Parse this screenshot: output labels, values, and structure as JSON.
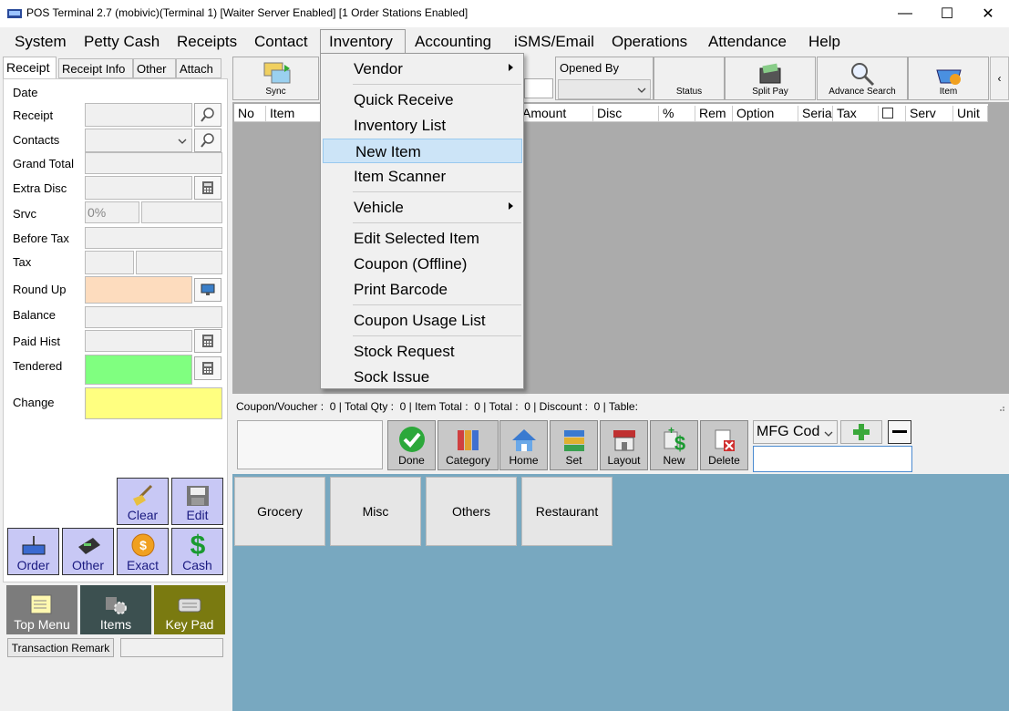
{
  "window": {
    "title": "POS Terminal 2.7 (mobivic)(Terminal 1) [Waiter Server Enabled] [1 Order Stations Enabled]",
    "minimize": "—",
    "maximize": "☐",
    "close": "✕"
  },
  "menubar": [
    "System",
    "Petty Cash",
    "Receipts",
    "Contact",
    "Inventory",
    "Accounting",
    "iSMS/Email",
    "Operations",
    "Attendance",
    "Help"
  ],
  "left": {
    "tabs": [
      "Receipt",
      "Receipt Info",
      "Other",
      "Attach"
    ],
    "labels": {
      "date": "Date",
      "receipt": "Receipt",
      "contacts": "Contacts",
      "grand_total": "Grand Total",
      "extra_disc": "Extra Disc",
      "srvc": "Srvc",
      "before_tax": "Before Tax",
      "tax": "Tax",
      "round_up": "Round Up",
      "balance": "Balance",
      "paid_hist": "Paid Hist",
      "tendered": "Tendered",
      "change": "Change"
    },
    "srvc_value": "0%",
    "buttons": {
      "clear": "Clear",
      "edit": "Edit",
      "order": "Order",
      "other": "Other",
      "exact": "Exact",
      "cash": "Cash"
    },
    "nav": {
      "top_menu": "Top Menu",
      "items": "Items",
      "key_pad": "Key Pad"
    },
    "remark_button": "Transaction Remark"
  },
  "toolbar": {
    "sync": "Sync",
    "opened_by": "Opened By",
    "status": "Status",
    "split_pay": "Split Pay",
    "advance_search": "Advance Search",
    "item": "Item",
    "collapse": "‹"
  },
  "grid": {
    "columns": [
      "No",
      "Item",
      "Amount",
      "Disc",
      "%",
      "Rem",
      "Option",
      "Seria",
      "Tax",
      "",
      "Serv",
      "Unit"
    ]
  },
  "summary": "Coupon/Voucher :  0 | Total Qty :  0 | Item Total :  0 | Total :  0 | Discount :  0 | Table:",
  "actions": [
    "Done",
    "Category",
    "Home",
    "Set",
    "Layout",
    "New",
    "Delete"
  ],
  "mfg": {
    "value": "MFG Cod",
    "plus": "+",
    "minus": "—"
  },
  "categories": [
    "Grocery",
    "Misc",
    "Others",
    "Restaurant"
  ],
  "dropdown": {
    "items": [
      "Vendor",
      "Quick Receive",
      "Inventory List",
      "New Item",
      "Item Scanner",
      "Vehicle",
      "Edit Selected Item",
      "Coupon (Offline)",
      "Print Barcode",
      "Coupon Usage List",
      "Stock Request",
      "Sock Issue"
    ],
    "highlighted": "New Item"
  },
  "colors": {
    "round_up": "#fddcbe",
    "tendered": "#80ff80",
    "change": "#ffff80",
    "grid_bg": "#ababab",
    "category_bg": "#78a8c0",
    "button_violet": "#c8c8f5",
    "nav_top_menu": "#7c7c7c",
    "nav_items": "#3c5050",
    "nav_keypad": "#7a7a10"
  }
}
